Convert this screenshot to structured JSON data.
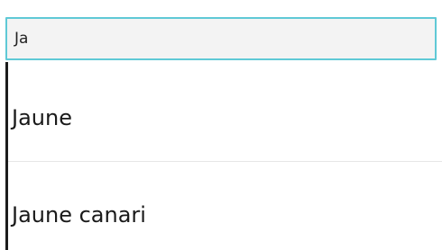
{
  "search": {
    "value": "Ja"
  },
  "results": {
    "items": [
      {
        "label": "Jaune"
      },
      {
        "label": "Jaune canari"
      }
    ]
  },
  "colors": {
    "input_focus_border": "#5fc9d6",
    "input_background": "#f3f3f3",
    "left_edge": "#1c1c1c",
    "divider": "#e6e6e6"
  }
}
